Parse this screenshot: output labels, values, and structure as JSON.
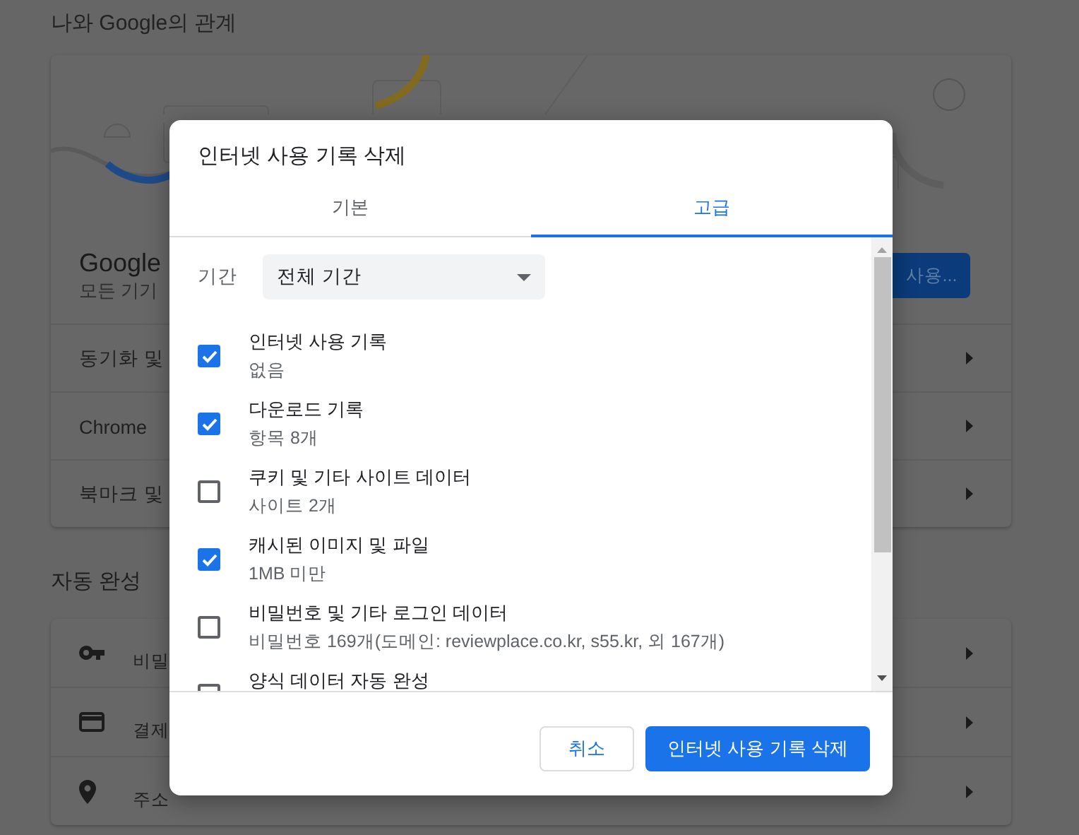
{
  "background": {
    "heading": "나와 Google의 관계",
    "account": {
      "title": "Google",
      "subtitle": "모든 기기",
      "button": "사용..."
    },
    "rows": [
      {
        "label": "동기화 및"
      },
      {
        "label": "Chrome"
      },
      {
        "label": "북마크 및"
      }
    ],
    "autofill_heading": "자동 완성",
    "autofill_rows": [
      {
        "kind": "key",
        "label": "비밀"
      },
      {
        "kind": "card",
        "label": "결제"
      },
      {
        "kind": "pin",
        "label": "주소"
      }
    ]
  },
  "dialog": {
    "title": "인터넷 사용 기록 삭제",
    "tabs": [
      {
        "label": "기본",
        "selected": false
      },
      {
        "label": "고급",
        "selected": true
      }
    ],
    "period": {
      "label": "기간",
      "value": "전체 기간"
    },
    "items": [
      {
        "title": "인터넷 사용 기록",
        "detail": "없음",
        "checked": true
      },
      {
        "title": "다운로드 기록",
        "detail": "항목 8개",
        "checked": true
      },
      {
        "title": "쿠키 및 기타 사이트 데이터",
        "detail": "사이트 2개",
        "checked": false
      },
      {
        "title": "캐시된 이미지 및 파일",
        "detail": "1MB 미만",
        "checked": true
      },
      {
        "title": "비밀번호 및 기타 로그인 데이터",
        "detail": "비밀번호 169개(도메인: reviewplace.co.kr, s55.kr, 외 167개)",
        "checked": false
      },
      {
        "title": "양식 데이터 자동 완성",
        "checked": false
      }
    ],
    "buttons": [
      {
        "label": "취소",
        "kind": "secondary"
      },
      {
        "label": "인터넷 사용 기록 삭제",
        "kind": "primary"
      }
    ]
  }
}
